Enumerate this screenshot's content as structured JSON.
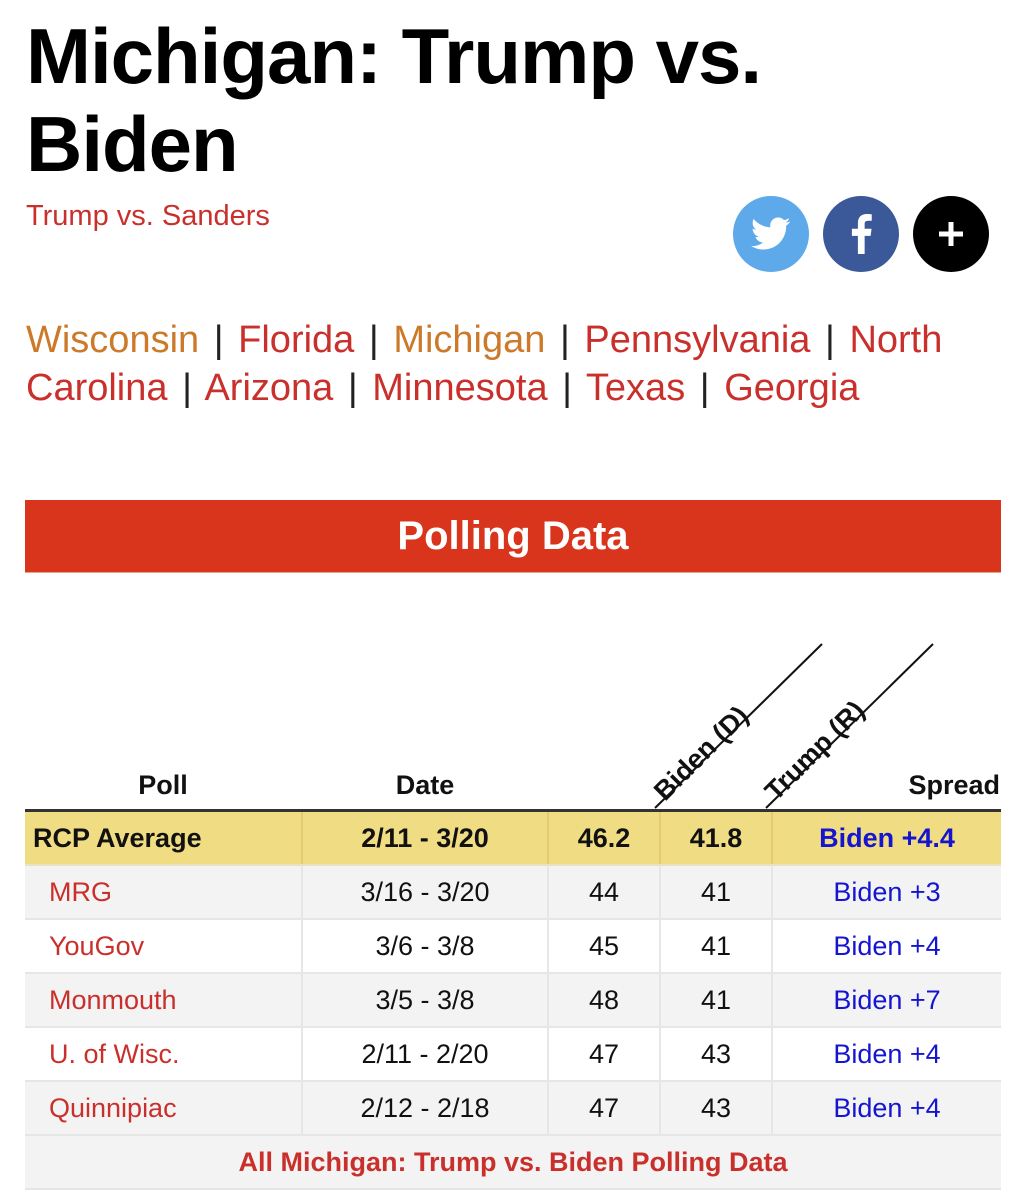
{
  "page": {
    "title": "Michigan: Trump vs. Biden",
    "alt_matchup_link": "Trump vs. Sanders"
  },
  "share": [
    {
      "icon": "twitter-icon",
      "label": "Twitter",
      "color": "#5ea9ea"
    },
    {
      "icon": "facebook-icon",
      "label": "Facebook",
      "color": "#3b5998"
    },
    {
      "icon": "plus-icon",
      "label": "More",
      "color": "#000000"
    }
  ],
  "states": [
    {
      "label": "Wisconsin",
      "highlight": true
    },
    {
      "label": "Florida",
      "highlight": false
    },
    {
      "label": "Michigan",
      "highlight": true
    },
    {
      "label": "Pennsylvania",
      "highlight": false
    },
    {
      "label": "North Carolina",
      "highlight": false
    },
    {
      "label": "Arizona",
      "highlight": false
    },
    {
      "label": "Minnesota",
      "highlight": false
    },
    {
      "label": "Texas",
      "highlight": false
    },
    {
      "label": "Georgia",
      "highlight": false
    }
  ],
  "state_separator": "|",
  "section": {
    "banner_title": "Polling Data"
  },
  "table": {
    "headers": {
      "poll": "Poll",
      "date": "Date",
      "biden": "Biden (D)",
      "trump": "Trump (R)",
      "spread": "Spread"
    },
    "average": {
      "poll": "RCP Average",
      "date": "2/11 - 3/20",
      "biden": "46.2",
      "trump": "41.8",
      "spread": "Biden +4.4"
    },
    "rows": [
      {
        "poll": "MRG",
        "date": "3/16 - 3/20",
        "biden": "44",
        "trump": "41",
        "spread": "Biden +3"
      },
      {
        "poll": "YouGov",
        "date": "3/6 - 3/8",
        "biden": "45",
        "trump": "41",
        "spread": "Biden +4"
      },
      {
        "poll": "Monmouth",
        "date": "3/5 - 3/8",
        "biden": "48",
        "trump": "41",
        "spread": "Biden +7"
      },
      {
        "poll": "U. of Wisc.",
        "date": "2/11 - 2/20",
        "biden": "47",
        "trump": "43",
        "spread": "Biden +4"
      },
      {
        "poll": "Quinnipiac",
        "date": "2/12 - 2/18",
        "biden": "47",
        "trump": "43",
        "spread": "Biden +4"
      }
    ],
    "footer_link": "All Michigan: Trump vs. Biden Polling Data"
  },
  "colors": {
    "link_red": "#c9302c",
    "link_orange": "#cc7a2a",
    "banner_red": "#d9341c",
    "average_row": "#f0dc82",
    "spread_blue": "#1515d0"
  }
}
